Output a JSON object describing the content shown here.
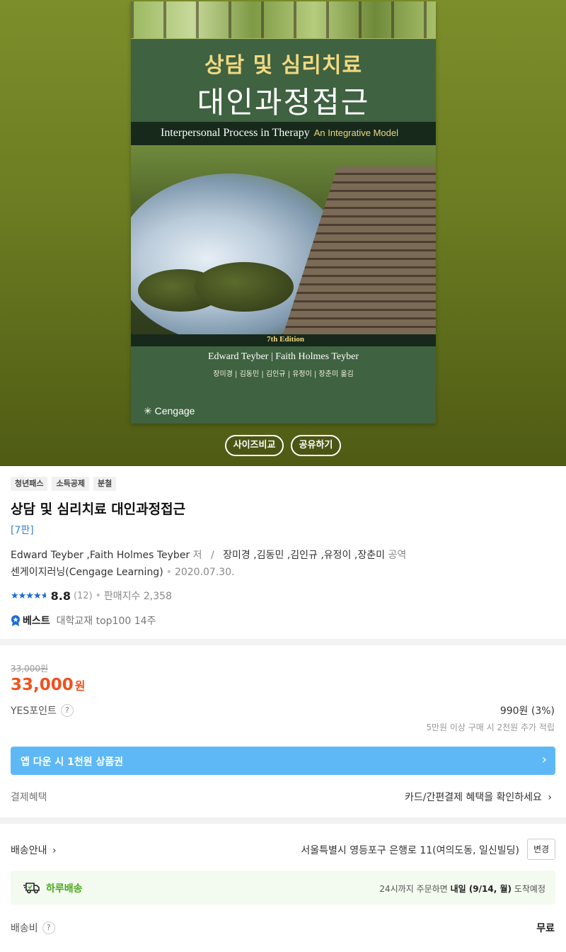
{
  "cover": {
    "title_ko_1": "상담 및 심리치료",
    "title_ko_2": "대인과정접근",
    "title_en": "Interpersonal Process in Therapy",
    "title_en_sub": "An Integrative Model",
    "edition": "7th Edition",
    "authors_en": "Edward Teyber | Faith Holmes Teyber",
    "translators": "장미경 | 김동민 | 김인규 | 유정이 | 장춘미  옮김",
    "publisher_logo": "Cengage"
  },
  "hero_buttons": {
    "size_compare": "사이즈비교",
    "share": "공유하기"
  },
  "tags": [
    "청년패스",
    "소득공제",
    "분철"
  ],
  "product": {
    "title": "상담 및 심리치료 대인과정접근",
    "edition": "[7판]",
    "authors": "Edward Teyber ,Faith Holmes Teyber",
    "author_role": "저",
    "slash": "/",
    "translators": "장미경 ,김동민 ,김인규 ,유정이 ,장춘미",
    "translator_role": "공역",
    "publisher": "센게이지러닝(Cengage Learning)",
    "date": "2020.07.30.",
    "rating_score": "8.8",
    "rating_count": "(12)",
    "rating_stars": 4.5,
    "sales": "판매지수 2,358",
    "best_label": "베스트",
    "best_desc": "대학교재 top100 14주"
  },
  "price": {
    "original": "33,000원",
    "sale_amount": "33,000",
    "sale_unit": "원",
    "point_label": "YES포인트",
    "point_value": "990원 (3%)",
    "point_note": "5만원 이상 구매 시 2천원 추가 적립",
    "app_banner": "앱 다운 시 1천원 상품권",
    "payment_label": "결제혜택",
    "payment_link": "카드/간편결제 혜택을 확인하세요"
  },
  "shipping": {
    "label": "배송안내",
    "address": "서울특별시 영등포구 은행로 11(여의도동, 일신빌딩)",
    "change_button": "변경",
    "fast_label": "하루배송",
    "fast_note_prefix": "24시까지 주문하면",
    "fast_note_date": "내일 (9/14, 월)",
    "fast_note_suffix": "도착예정",
    "fee_label": "배송비",
    "fee_value": "무료"
  },
  "colors": {
    "accent_price": "#f0511e",
    "edition_link": "#3a7fd6",
    "star": "#1c6bd6",
    "app_banner": "#5eb8f6",
    "fast_delivery": "#4ba91e"
  },
  "icons": {
    "question": "question-mark-icon",
    "chevron": "chevron-right-icon",
    "best": "ribbon-star-icon",
    "truck": "delivery-truck-icon"
  }
}
